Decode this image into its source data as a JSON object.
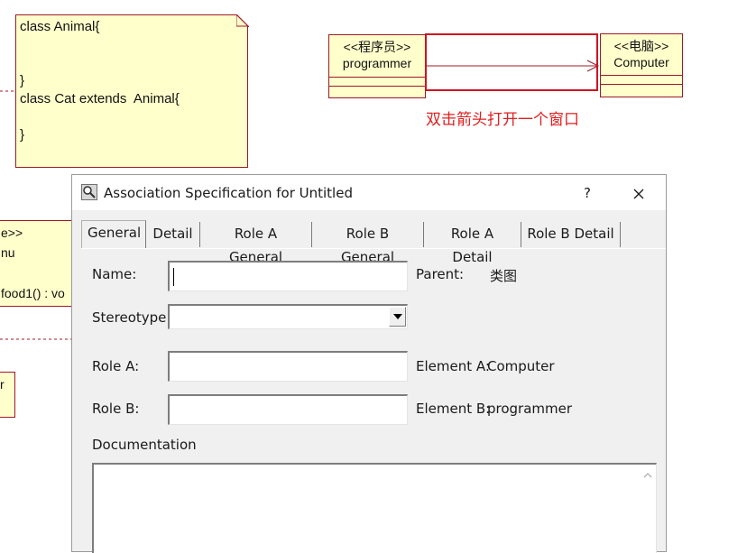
{
  "diagram": {
    "note_lines": [
      "class Animal{",
      "}",
      "class Cat extends  Animal{",
      "}"
    ],
    "class_programmer": {
      "stereotype": "<<程序员>>",
      "name": "programmer"
    },
    "class_computer": {
      "stereotype": "<<电脑>>",
      "name": "Computer"
    },
    "hint_text": "双击箭头打开一个窗口",
    "partial_class": {
      "stereotype_tail": "e>>",
      "name_tail": "nu",
      "operation": "food1() : vo",
      "name2_tail": "r"
    },
    "colors": {
      "note_fill": "#ffffcc",
      "border": "#a0182a",
      "selection": "#d01020",
      "hint": "#e02020"
    }
  },
  "dialog": {
    "title": "Association Specification for Untitled",
    "help_label": "?",
    "tabs": [
      "General",
      "Detail",
      "Role A General",
      "Role B General",
      "Role A Detail",
      "Role B Detail"
    ],
    "active_tab": "General",
    "form": {
      "name_label": "Name:",
      "name_value": "",
      "parent_label": "Parent:",
      "parent_value": "类图",
      "stereotype_label": "Stereotype:",
      "stereotype_value": "",
      "role_a_label": "Role A:",
      "role_a_value": "",
      "element_a_label": "Element A:",
      "element_a_value": "Computer",
      "role_b_label": "Role B:",
      "role_b_value": "",
      "element_b_label": "Element B:",
      "element_b_value": "programmer",
      "documentation_label": "Documentation",
      "documentation_value": ""
    },
    "icons": {
      "title": "magnifier-icon",
      "close": "close-icon",
      "dropdown": "chevron-down-icon",
      "scroll_up": "scroll-up-arrow-icon"
    }
  }
}
